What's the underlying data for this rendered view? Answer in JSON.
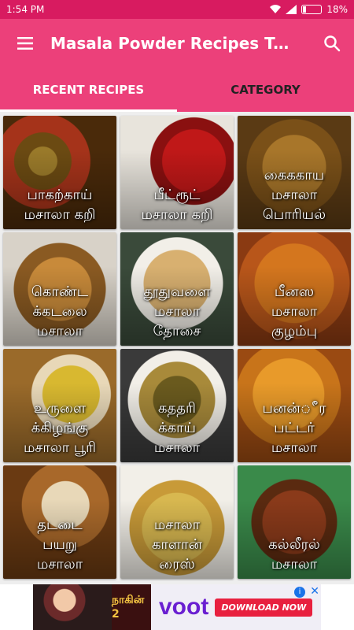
{
  "status_bar": {
    "time": "1:54 PM",
    "battery": "18%",
    "battery_level": 0.18
  },
  "app_bar": {
    "title": "Masala Powder Recipes Ta...",
    "menu_icon": "hamburger-menu-icon",
    "search_icon": "search-icon"
  },
  "tabs": [
    {
      "label": "RECENT RECIPES",
      "active": true
    },
    {
      "label": "CATEGORY",
      "active": false
    }
  ],
  "recipes": [
    {
      "name": "பாகற்காய்\nமசாலா கறி"
    },
    {
      "name": "பீட்ரூட்\nமசாலா கறி"
    },
    {
      "name": "கைககாய\nமசாலா\nபொரியல்"
    },
    {
      "name": "கொண்ட\nக்கடலை\nமசாலா"
    },
    {
      "name": "தூதுவளை\nமசாலா\nதோசை"
    },
    {
      "name": "பீனஸ\nமசாலா\nகுழம்பு"
    },
    {
      "name": "உருளை\nக்கிழங்கு\nமசாலா பூரி"
    },
    {
      "name": "கததரி\nக்காய்\nமசாலா"
    },
    {
      "name": "பனன்ீர\nபட்டர்\nமசாலா"
    },
    {
      "name": "தடடை\nபயறு\nமசாலா"
    },
    {
      "name": "மசாலா\nகாளான்\nரைஸ்"
    },
    {
      "name": "கல்லீரல்\nமசாலா"
    }
  ],
  "ad": {
    "show_title": "நாகின் 2",
    "brand": "voot",
    "cta": "DOWNLOAD NOW"
  },
  "colors": {
    "status_bar": "#d81b60",
    "app_bar": "#ec407a",
    "accent": "#ffffff"
  }
}
